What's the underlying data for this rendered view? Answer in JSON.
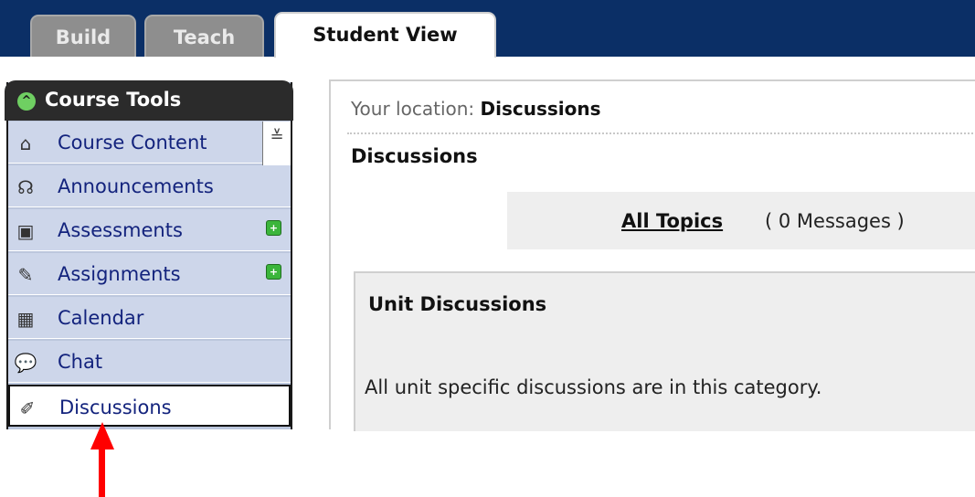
{
  "tabs": [
    {
      "label": "Build"
    },
    {
      "label": "Teach"
    },
    {
      "label": "Student View"
    }
  ],
  "sidebar": {
    "header": "Course Tools",
    "collapse_glyph": "≚",
    "items": [
      {
        "label": "Course Content",
        "icon": "house-icon"
      },
      {
        "label": "Announcements",
        "icon": "megaphone-icon"
      },
      {
        "label": "Assessments",
        "icon": "assessment-icon"
      },
      {
        "label": "Assignments",
        "icon": "assignment-icon"
      },
      {
        "label": "Calendar",
        "icon": "calendar-icon"
      },
      {
        "label": "Chat",
        "icon": "chat-icon"
      },
      {
        "label": "Discussions",
        "icon": "pushpin-icon"
      }
    ]
  },
  "main": {
    "location_prefix": "Your location:",
    "location_value": "Discussions",
    "page_title": "Discussions",
    "topics_link": "All Topics",
    "topics_count": "( 0 Messages )",
    "category_title": "Unit Discussions",
    "category_desc": "All unit specific discussions are in this category."
  },
  "colors": {
    "topbar": "#0b2f66",
    "menu_bg": "#cdd6ea",
    "menu_text": "#13237d",
    "new_badge": "#3bb53b",
    "annotation_arrow": "#ff0000"
  }
}
